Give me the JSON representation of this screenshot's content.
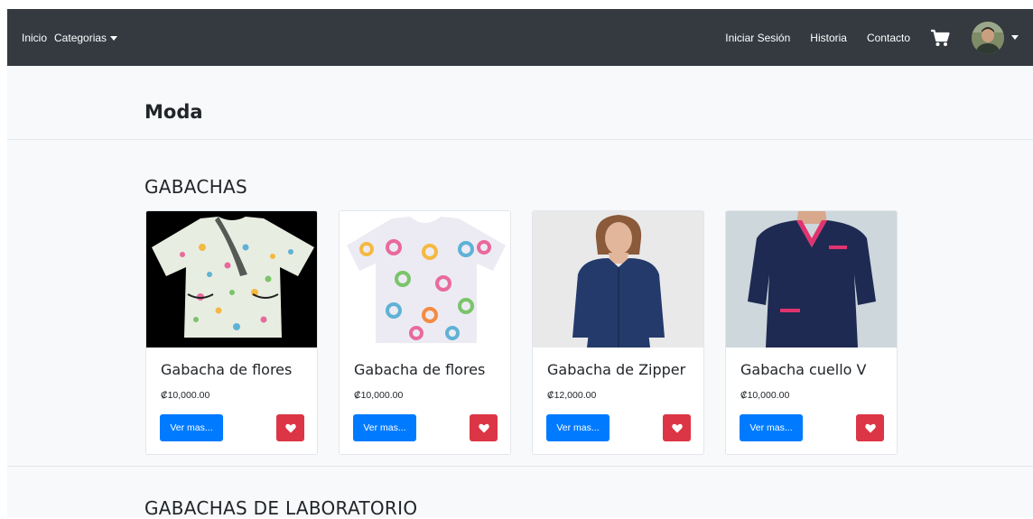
{
  "nav": {
    "home": "Inicio",
    "categories": "Categorias",
    "login": "Iniciar Sesión",
    "history": "Historia",
    "contact": "Contacto",
    "cart_icon": "shopping-cart-icon",
    "avatar_icon": "user-avatar"
  },
  "page": {
    "title": "Moda"
  },
  "sections": [
    {
      "title": "GABACHAS",
      "products": [
        {
          "name": "Gabacha de flores",
          "price": "₡10,000.00",
          "button": "Ver mas..."
        },
        {
          "name": "Gabacha de flores",
          "price": "₡10,000.00",
          "button": "Ver mas..."
        },
        {
          "name": "Gabacha de Zipper",
          "price": "₡12,000.00",
          "button": "Ver mas..."
        },
        {
          "name": "Gabacha cuello V",
          "price": "₡10,000.00",
          "button": "Ver mas..."
        }
      ]
    },
    {
      "title": "GABACHAS DE LABORATORIO"
    }
  ],
  "colors": {
    "navbar": "#343a40",
    "primary": "#007bff",
    "danger": "#dc3545",
    "background": "#f8f9fa"
  }
}
